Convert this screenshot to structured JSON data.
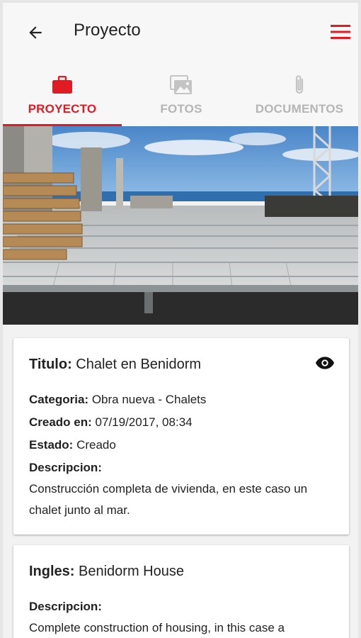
{
  "appbar": {
    "title": "Proyecto",
    "back_icon": "arrow-left-icon",
    "menu_icon": "hamburger-menu-icon",
    "accent_color": "#e01b24"
  },
  "tabs": [
    {
      "label": "PROYECTO",
      "icon": "briefcase-icon",
      "active": true
    },
    {
      "label": "FOTOS",
      "icon": "photos-icon",
      "active": false
    },
    {
      "label": "DOCUMENTOS",
      "icon": "paperclip-icon",
      "active": false
    }
  ],
  "project": {
    "titulo_label": "Titulo:",
    "titulo_value": "Chalet en Benidorm",
    "categoria_label": "Categoria:",
    "categoria_value": "Obra nueva - Chalets",
    "creado_label": "Creado en:",
    "creado_value": "07/19/2017, 08:34",
    "estado_label": "Estado:",
    "estado_value": "Creado",
    "estado_color": "#2ecc40",
    "descripcion_label": "Descripcion:",
    "descripcion_value": "Construcción completa de vivienda, en este caso un chalet junto al mar."
  },
  "english": {
    "ingles_label": "Ingles:",
    "ingles_value": "Benidorm House",
    "descripcion_label": "Descripcion:",
    "descripcion_value": "Complete construction of housing, in this case a"
  }
}
